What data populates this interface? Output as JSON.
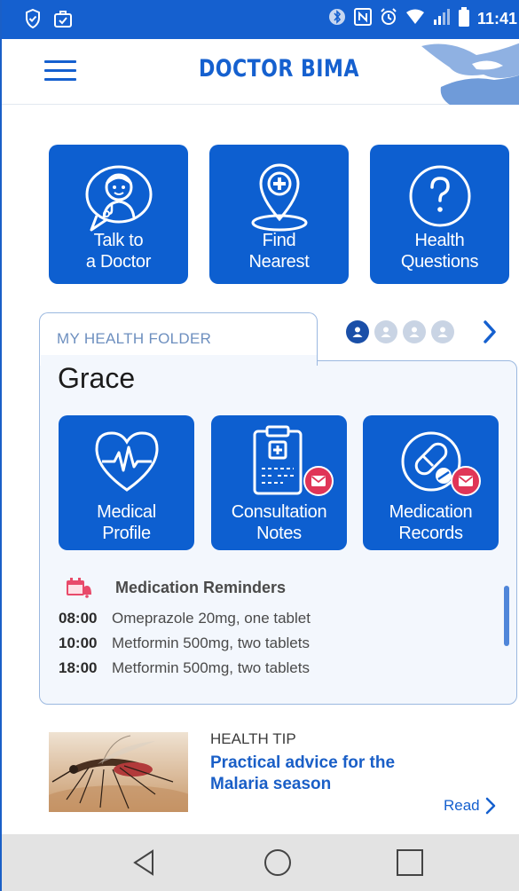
{
  "status_bar": {
    "time": "11:41",
    "icons": [
      "shield-check-icon",
      "briefcase-check-icon",
      "bluetooth-icon",
      "nfc-icon",
      "alarm-icon",
      "wifi-icon",
      "signal-icon",
      "battery-icon"
    ]
  },
  "header": {
    "title": "DOCTOR BIMA",
    "menu_icon": "hamburger-menu-icon",
    "logo": "hands-logo"
  },
  "quick_actions": [
    {
      "label_line1": "Talk to",
      "label_line2": "a Doctor",
      "icon": "doctor-chat-icon"
    },
    {
      "label_line1": "Find",
      "label_line2": "Nearest",
      "icon": "location-pin-cross-icon"
    },
    {
      "label_line1": "Health",
      "label_line2": "Questions",
      "icon": "question-circle-icon"
    }
  ],
  "health_folder": {
    "title": "MY HEALTH FOLDER",
    "person_name": "Grace",
    "profile_count": 4,
    "active_profile": 1,
    "tiles": [
      {
        "label_line1": "Medical",
        "label_line2": "Profile",
        "icon": "heart-pulse-icon",
        "badge": false
      },
      {
        "label_line1": "Consultation",
        "label_line2": "Notes",
        "icon": "clipboard-cross-icon",
        "badge": true
      },
      {
        "label_line1": "Medication",
        "label_line2": "Records",
        "icon": "pills-icon",
        "badge": true
      }
    ],
    "reminders": {
      "title": "Medication Reminders",
      "items": [
        {
          "time": "08:00",
          "text": "Omeprazole 20mg, one tablet"
        },
        {
          "time": "10:00",
          "text": "Metformin 500mg, two tablets"
        },
        {
          "time": "18:00",
          "text": "Metformin 500mg, two tablets"
        }
      ]
    }
  },
  "health_tip": {
    "kicker": "HEALTH TIP",
    "title": "Practical advice for the Malaria season",
    "read_label": "Read",
    "image": "mosquito-photo"
  },
  "colors": {
    "primary": "#1560cf",
    "tile": "#0d5fd0",
    "badge": "#e03557",
    "folder_border": "#9bb8e0"
  }
}
